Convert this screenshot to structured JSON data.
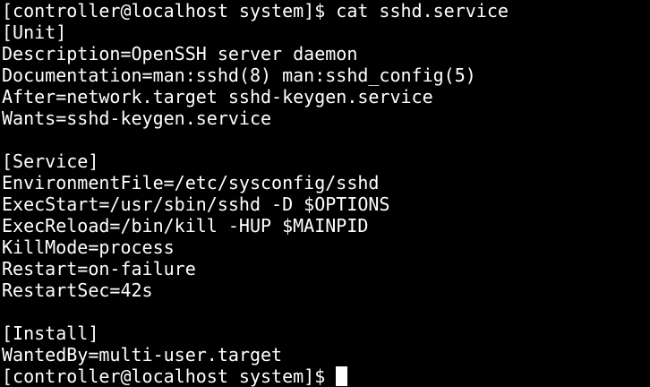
{
  "terminal": {
    "command_prompt": "[controller@localhost system]$ cat sshd.service",
    "output": [
      "[Unit]",
      "Description=OpenSSH server daemon",
      "Documentation=man:sshd(8) man:sshd_config(5)",
      "After=network.target sshd-keygen.service",
      "Wants=sshd-keygen.service",
      "",
      "[Service]",
      "EnvironmentFile=/etc/sysconfig/sshd",
      "ExecStart=/usr/sbin/sshd -D $OPTIONS",
      "ExecReload=/bin/kill -HUP $MAINPID",
      "KillMode=process",
      "Restart=on-failure",
      "RestartSec=42s",
      "",
      "[Install]",
      "WantedBy=multi-user.target"
    ],
    "final_prompt": "[controller@localhost system]$ "
  },
  "colors": {
    "background": "#000000",
    "foreground": "#ffffff",
    "cursor": "#ffffff"
  }
}
